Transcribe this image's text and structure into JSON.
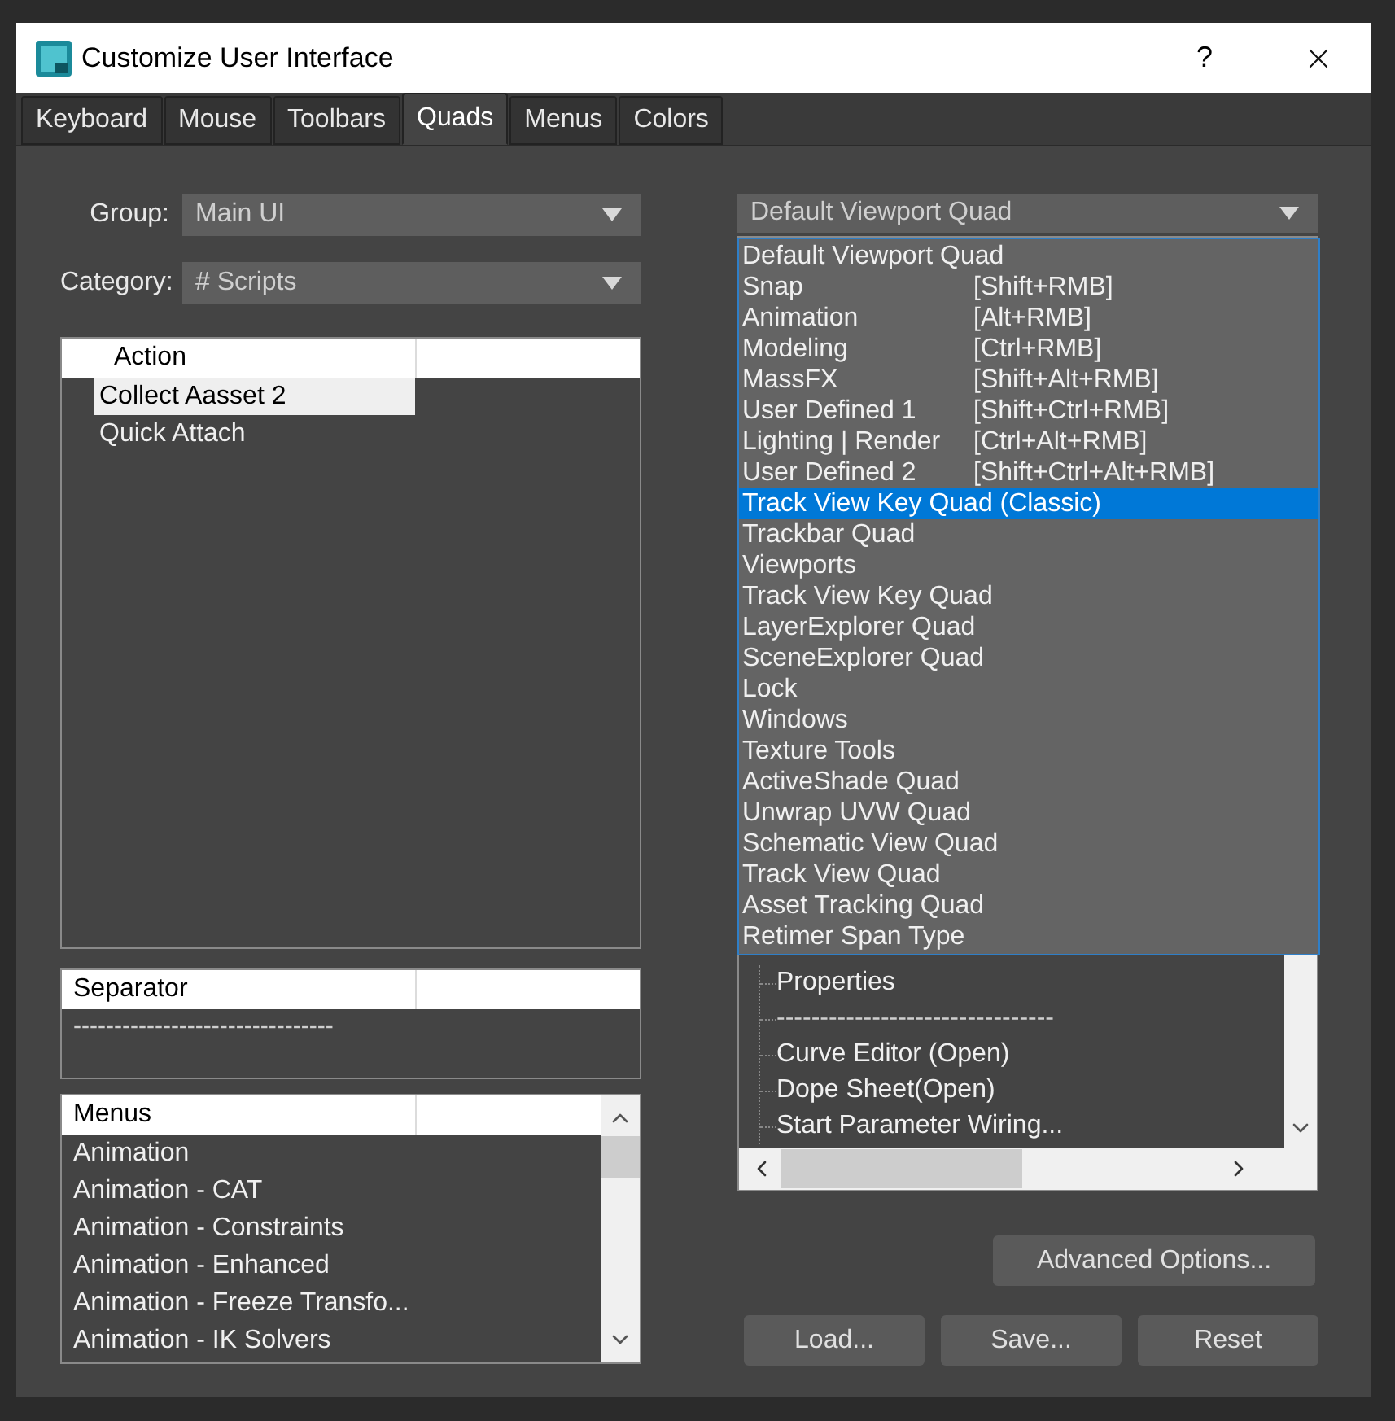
{
  "window": {
    "title": "Customize User Interface",
    "help": "?"
  },
  "tabs": [
    {
      "label": "Keyboard",
      "selected": false
    },
    {
      "label": "Mouse",
      "selected": false
    },
    {
      "label": "Toolbars",
      "selected": false
    },
    {
      "label": "Quads",
      "selected": true
    },
    {
      "label": "Menus",
      "selected": false
    },
    {
      "label": "Colors",
      "selected": false
    }
  ],
  "group": {
    "label": "Group:",
    "value": "Main UI"
  },
  "category": {
    "label": "Category:",
    "value": "# Scripts"
  },
  "action_list": {
    "column": "Action",
    "rows": [
      {
        "label": "Collect Aasset 2",
        "selected": true
      },
      {
        "label": "Quick Attach",
        "selected": false
      }
    ]
  },
  "separator_list": {
    "column": "Separator",
    "rows": [
      "--------------------------------"
    ]
  },
  "menus_list": {
    "column": "Menus",
    "rows": [
      "Animation",
      "Animation - CAT",
      "Animation - Constraints",
      "Animation - Enhanced",
      "Animation - Freeze Transfo...",
      "Animation - IK Solvers"
    ]
  },
  "quad_select": {
    "value": "Default Viewport Quad"
  },
  "quad_dropdown": [
    {
      "label": "Default Viewport Quad",
      "selected": false
    },
    {
      "label": "Snap",
      "shortcut": "[Shift+RMB]",
      "selected": false
    },
    {
      "label": "Animation",
      "shortcut": "[Alt+RMB]",
      "selected": false
    },
    {
      "label": "Modeling",
      "shortcut": "[Ctrl+RMB]",
      "selected": false
    },
    {
      "label": "MassFX",
      "shortcut": "[Shift+Alt+RMB]",
      "selected": false
    },
    {
      "label": "User Defined 1",
      "shortcut": "[Shift+Ctrl+RMB]",
      "selected": false
    },
    {
      "label": "Lighting | Render",
      "shortcut": "[Ctrl+Alt+RMB]",
      "selected": false
    },
    {
      "label": "User Defined 2",
      "shortcut": "[Shift+Ctrl+Alt+RMB]",
      "selected": false
    },
    {
      "label": "Track View Key Quad (Classic)",
      "selected": true
    },
    {
      "label": "Trackbar Quad",
      "selected": false
    },
    {
      "label": "Viewports",
      "selected": false
    },
    {
      "label": "Track View Key Quad",
      "selected": false
    },
    {
      "label": "LayerExplorer Quad",
      "selected": false
    },
    {
      "label": "SceneExplorer Quad",
      "selected": false
    },
    {
      "label": "Lock",
      "selected": false
    },
    {
      "label": "Windows",
      "selected": false
    },
    {
      "label": "Texture Tools",
      "selected": false
    },
    {
      "label": "ActiveShade Quad",
      "selected": false
    },
    {
      "label": "Unwrap UVW Quad",
      "selected": false
    },
    {
      "label": "Schematic View Quad",
      "selected": false
    },
    {
      "label": "Track View Quad",
      "selected": false
    },
    {
      "label": "Asset Tracking Quad",
      "selected": false
    },
    {
      "label": "Retimer Span Type",
      "selected": false
    }
  ],
  "quad_tree": [
    "Properties",
    "--------------------------------",
    "Curve Editor (Open)",
    "Dope Sheet(Open)",
    "Start Parameter Wiring..."
  ],
  "advanced_button": "Advanced Options...",
  "buttons": [
    "Load...",
    "Save...",
    "Reset"
  ]
}
